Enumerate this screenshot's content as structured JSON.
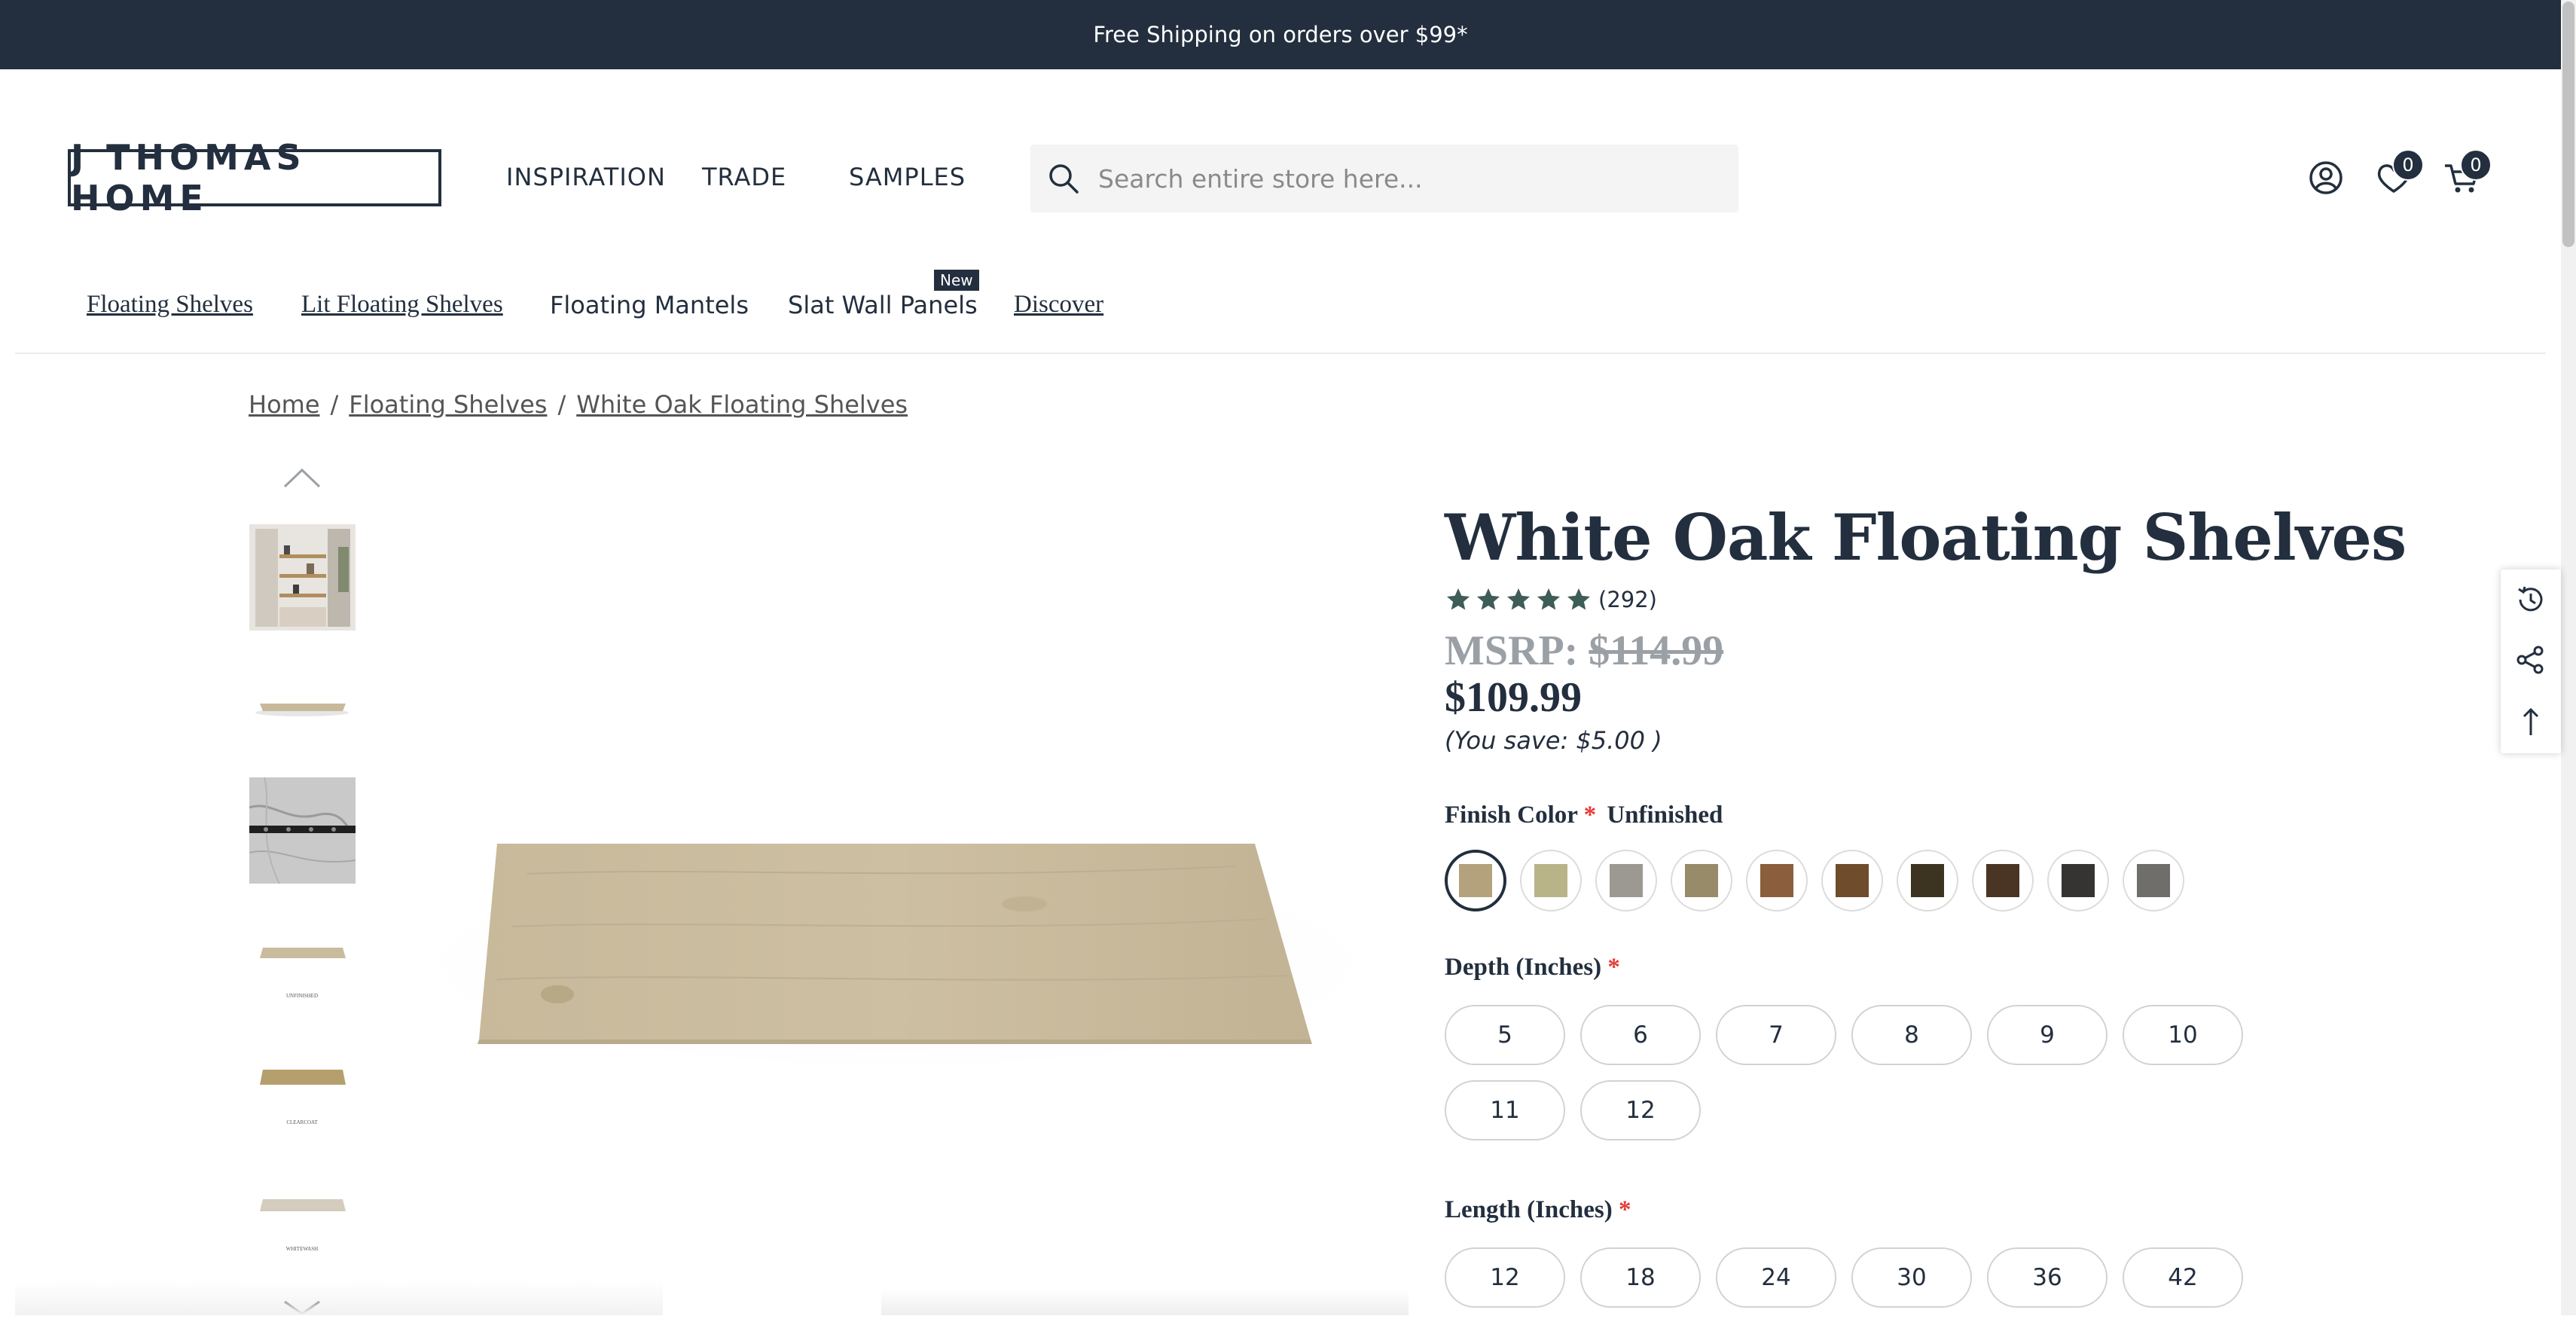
{
  "announcement": "Free Shipping on orders over $99*",
  "brand": {
    "logo_text": "J THOMAS HOME"
  },
  "main_nav": [
    "INSPIRATION",
    "TRADE",
    "SAMPLES"
  ],
  "search": {
    "placeholder": "Search entire store here...",
    "icon": "search-icon"
  },
  "header_icons": {
    "account": "account-icon",
    "wishlist": "heart-icon",
    "wishlist_count": "0",
    "cart": "cart-icon",
    "cart_count": "0"
  },
  "category_nav": [
    {
      "label": "Floating Shelves"
    },
    {
      "label": "Lit Floating Shelves"
    },
    {
      "label": "Floating Mantels"
    },
    {
      "label": "Slat Wall Panels",
      "badge": "New"
    },
    {
      "label": "Discover"
    }
  ],
  "breadcrumb": [
    "Home",
    "Floating Shelves",
    "White Oak Floating Shelves"
  ],
  "thumbnails": [
    {
      "icon": "thumbnail-shelving-room"
    },
    {
      "icon": "thumbnail-shelf"
    },
    {
      "icon": "thumbnail-marble-hardware"
    },
    {
      "icon": "thumbnail-unfinished",
      "caption": "UNFINISHED"
    },
    {
      "icon": "thumbnail-clearcoat",
      "caption": "CLEARCOAT"
    },
    {
      "icon": "thumbnail-whitewash",
      "caption": "WHITEWASH"
    }
  ],
  "product": {
    "title": "White Oak Floating Shelves",
    "rating": 5,
    "review_count": "(292)",
    "msrp_label": "MSRP:",
    "msrp_value": "$114.99",
    "price": "$109.99",
    "savings": "(You save: $5.00 )"
  },
  "finish": {
    "label": "Finish Color",
    "required_mark": "*",
    "selected": "Unfinished",
    "swatches": [
      "#b3a27c",
      "#b9b487",
      "#9c9993",
      "#978b6a",
      "#8b5e3d",
      "#6f4c2c",
      "#3c3320",
      "#4a3423",
      "#353433",
      "#6f6e6b"
    ]
  },
  "depth": {
    "label": "Depth (Inches)",
    "required_mark": "*",
    "options": [
      "5",
      "6",
      "7",
      "8",
      "9",
      "10",
      "11",
      "12"
    ]
  },
  "length": {
    "label": "Length (Inches)",
    "required_mark": "*",
    "options": [
      "12",
      "18",
      "24",
      "30",
      "36",
      "42"
    ]
  },
  "side_tools": [
    "history-icon",
    "share-icon",
    "back-to-top-icon"
  ],
  "colors": {
    "brand_dark": "#232f3e",
    "required": "#e53935",
    "msrp": "#9aa0a6"
  }
}
